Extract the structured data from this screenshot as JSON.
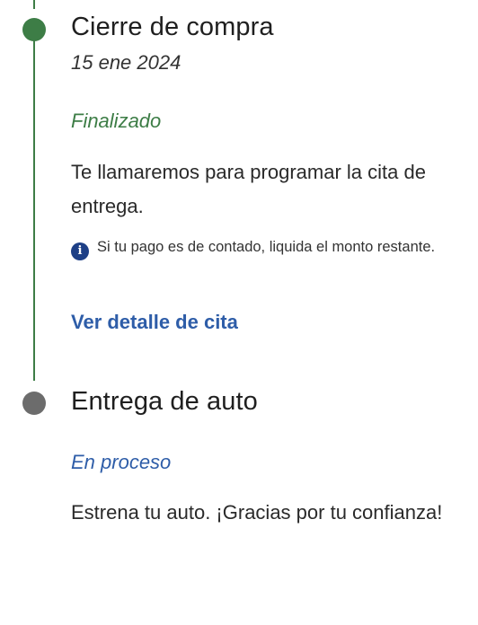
{
  "steps": [
    {
      "title": "Cierre de compra",
      "date": "15 ene 2024",
      "status": "Finalizado",
      "description": "Te llamaremos para programar la cita de entrega.",
      "info_icon": "info-circle-icon",
      "info": "Si tu pago es de contado, liquida el monto restante.",
      "link": "Ver detalle de cita",
      "color": "#3d7d46"
    },
    {
      "title": "Entrega de auto",
      "status": "En proceso",
      "description": "Estrena tu auto. ¡Gracias por tu confianza!",
      "color": "#6c6c6c"
    }
  ],
  "colors": {
    "done": "#3d7d46",
    "pending": "#6c6c6c",
    "link": "#2e5da8",
    "info_icon": "#1d3f86"
  }
}
